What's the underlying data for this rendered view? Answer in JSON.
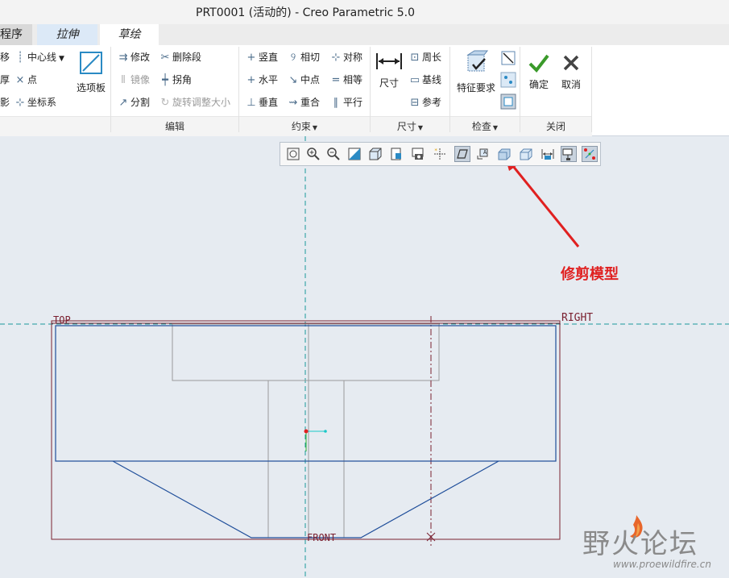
{
  "window": {
    "title": "PRT0001 (活动的) - Creo Parametric 5.0"
  },
  "tabs": [
    {
      "label": "程序"
    },
    {
      "label": "拉伸"
    },
    {
      "label": "草绘"
    }
  ],
  "ribbon": {
    "sketch_group": {
      "items": [
        {
          "label": "移",
          "icon": "move-icon"
        },
        {
          "label": "厚",
          "icon": "thicken-icon"
        },
        {
          "label": "影",
          "icon": "project-icon"
        }
      ],
      "datum_items": [
        {
          "label": "中心线",
          "icon": "centerline-icon"
        },
        {
          "label": "点",
          "icon": "point-icon"
        },
        {
          "label": "坐标系",
          "icon": "coordinate-system-icon"
        }
      ],
      "palette_label": "选项板"
    },
    "edit_group": {
      "label": "编辑",
      "items": [
        {
          "label": "修改",
          "icon": "modify-icon",
          "enabled": true
        },
        {
          "label": "删除段",
          "icon": "delete-segment-icon",
          "enabled": true
        },
        {
          "label": "镜像",
          "icon": "mirror-icon",
          "enabled": false
        },
        {
          "label": "拐角",
          "icon": "corner-icon",
          "enabled": true
        },
        {
          "label": "分割",
          "icon": "divide-icon",
          "enabled": true
        },
        {
          "label": "旋转调整大小",
          "icon": "rotate-resize-icon",
          "enabled": false
        }
      ]
    },
    "constrain_group": {
      "label": "约束",
      "items": [
        {
          "label": "竖直",
          "icon": "vertical-icon"
        },
        {
          "label": "相切",
          "icon": "tangent-icon"
        },
        {
          "label": "对称",
          "icon": "symmetric-icon"
        },
        {
          "label": "水平",
          "icon": "horizontal-icon"
        },
        {
          "label": "中点",
          "icon": "midpoint-icon"
        },
        {
          "label": "相等",
          "icon": "equal-icon"
        },
        {
          "label": "垂直",
          "icon": "perpendicular-icon"
        },
        {
          "label": "重合",
          "icon": "coincident-icon"
        },
        {
          "label": "平行",
          "icon": "parallel-icon"
        }
      ]
    },
    "dimension_group": {
      "label": "尺寸",
      "dimension_label": "尺寸",
      "items": [
        {
          "label": "周长",
          "icon": "perimeter-icon"
        },
        {
          "label": "基线",
          "icon": "baseline-icon"
        },
        {
          "label": "参考",
          "icon": "reference-icon"
        }
      ]
    },
    "inspect_group": {
      "label": "检查",
      "feature_req_label": "特征要求"
    },
    "close_group": {
      "label": "关闭",
      "ok_label": "确定",
      "cancel_label": "取消"
    }
  },
  "view_toolbar": {
    "buttons": [
      "refit-icon",
      "zoom-in-icon",
      "zoom-out-icon",
      "repaint-icon",
      "display-style-icon",
      "saved-orientations-icon",
      "view-manager-icon",
      "datum-display-icon",
      "spin-center-icon",
      "annotation-display-icon",
      "sketch-view-icon",
      "trim-model-icon",
      "shade-closed-icon",
      "dimension-display-icon",
      "constraint-display-icon",
      "vertex-display-icon"
    ],
    "toggled": [
      "spin-center-icon",
      "dimension-display-icon",
      "constraint-display-icon"
    ]
  },
  "canvas": {
    "datum_labels": {
      "top": "TOP",
      "right": "RIGHT",
      "front": "FRONT"
    },
    "annotation": "修剪模型"
  },
  "watermark": {
    "title": "野火论坛",
    "url": "www.proewildfire.cn"
  },
  "colors": {
    "sketch_line": "#1f4e9a",
    "model_edge": "#7a2030",
    "datum_plane": "#1a9a9a",
    "annotation": "#e02020",
    "active_tab": "#ffffff",
    "secondary_tab": "#dce9f7"
  }
}
